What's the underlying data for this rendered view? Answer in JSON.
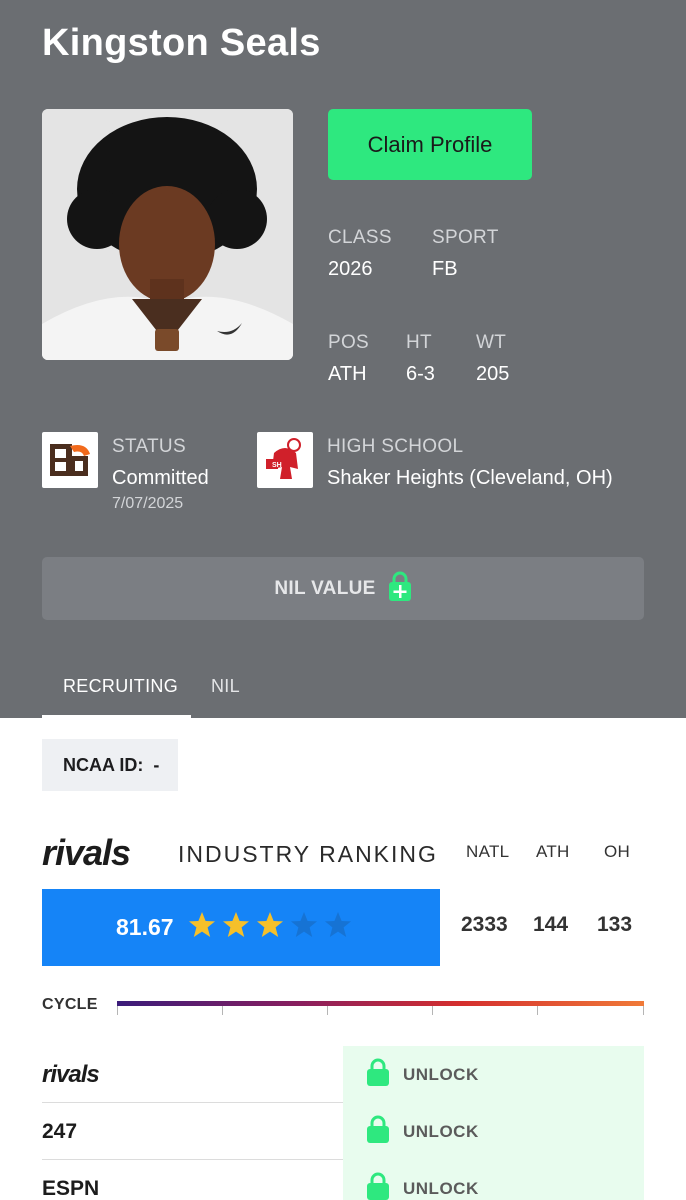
{
  "player": {
    "name": "Kingston Seals",
    "claim_label": "Claim Profile"
  },
  "stats": {
    "class_label": "CLASS",
    "class_value": "2026",
    "sport_label": "SPORT",
    "sport_value": "FB",
    "pos_label": "POS",
    "pos_value": "ATH",
    "ht_label": "HT",
    "ht_value": "6-3",
    "wt_label": "WT",
    "wt_value": "205"
  },
  "status": {
    "label": "STATUS",
    "value": "Committed",
    "date": "7/07/2025"
  },
  "high_school": {
    "label": "HIGH SCHOOL",
    "value": "Shaker Heights (Cleveland, OH)"
  },
  "nil_value_label": "NIL VALUE",
  "tabs": [
    {
      "label": "RECRUITING",
      "active": true
    },
    {
      "label": "NIL",
      "active": false
    }
  ],
  "ncaa": {
    "label": "NCAA ID:",
    "value": "-"
  },
  "ranking": {
    "brand": "rivals",
    "title": "INDUSTRY RANKING",
    "columns": [
      "NATL",
      "ATH",
      "OH"
    ],
    "score": "81.67",
    "stars_filled": 3,
    "stars_total": 5,
    "values": [
      "2333",
      "144",
      "133"
    ]
  },
  "cycle_label": "CYCLE",
  "services": [
    {
      "name": "rivals",
      "action": "UNLOCK"
    },
    {
      "name": "247",
      "action": "UNLOCK"
    },
    {
      "name": "ESPN",
      "action": "UNLOCK"
    }
  ],
  "colors": {
    "hero_bg": "#6b6e72",
    "accent_green": "#2ee87f",
    "rating_blue": "#1584f7",
    "star_gold": "#f5c02a",
    "star_empty": "#1673d4"
  },
  "icons": [
    "lock-plus-icon",
    "star-icon",
    "lock-icon",
    "team-logo",
    "school-logo"
  ]
}
